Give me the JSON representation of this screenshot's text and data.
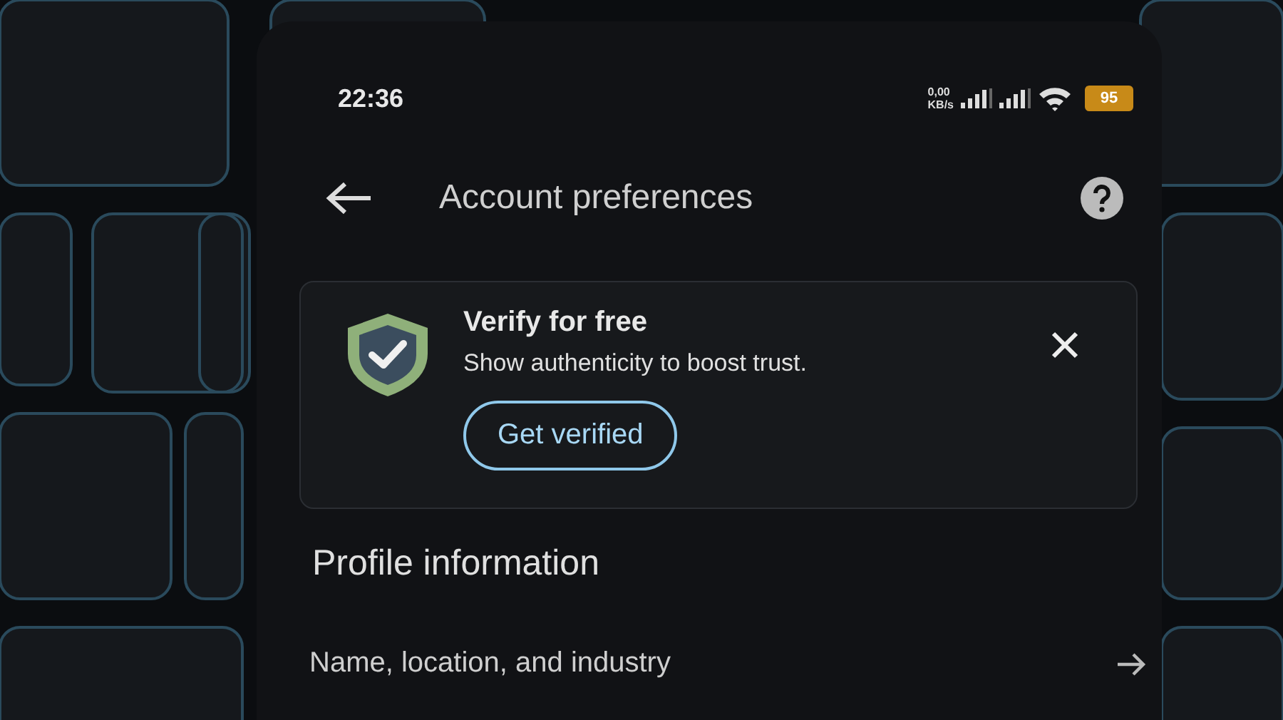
{
  "status_bar": {
    "time": "22:36",
    "data_rate": "0,00",
    "data_unit": "KB/s",
    "battery": "95"
  },
  "header": {
    "title": "Account preferences"
  },
  "banner": {
    "title": "Verify for free",
    "text": "Show authenticity to boost trust.",
    "button": "Get verified"
  },
  "section": {
    "title": "Profile information"
  },
  "rows": [
    {
      "label": "Name, location, and industry"
    }
  ]
}
